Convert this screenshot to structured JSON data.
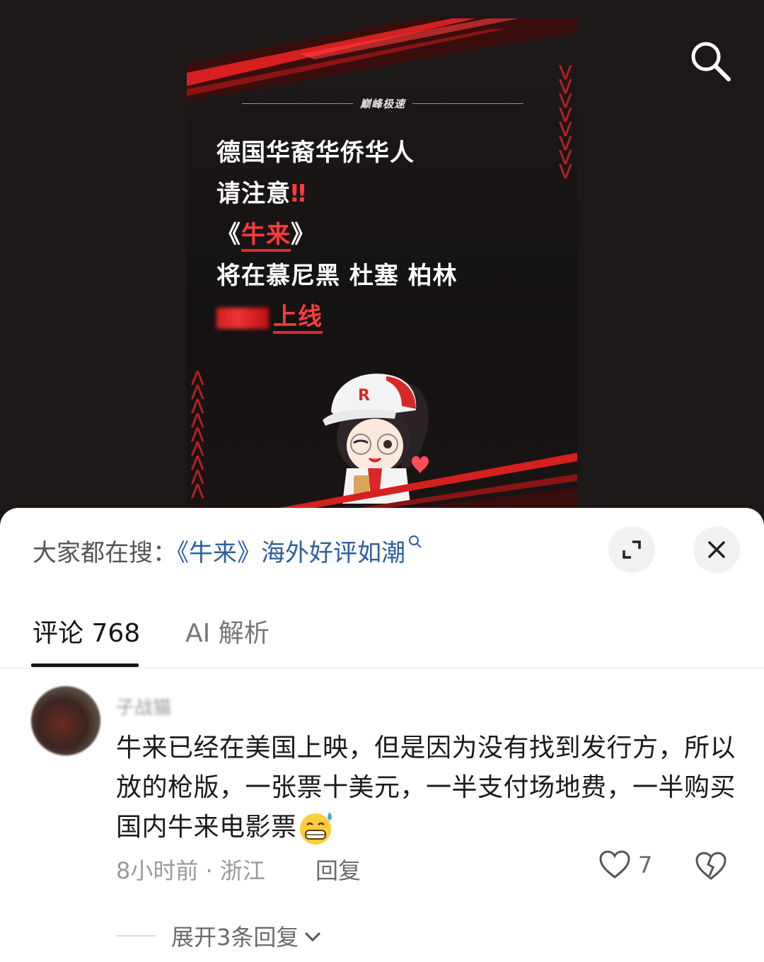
{
  "video": {
    "brand": "巅峰极速",
    "headline": {
      "line1": "德国华裔华侨华人",
      "line2": "请注意",
      "line2_mark": "‼",
      "line3_open": "《",
      "line3_title": "牛来",
      "line3_close": "》",
      "line4": "将在慕尼黑 杜塞 柏林",
      "line5": "上线"
    }
  },
  "search_icon": "search-icon",
  "sheet": {
    "suggestion_prefix": "大家都在搜：",
    "suggestion_link": "《牛来》海外好评如潮",
    "expand_icon": "expand-icon",
    "close_icon": "close-icon"
  },
  "tabs": [
    {
      "label": "评论 768"
    },
    {
      "label": "AI 解析"
    }
  ],
  "comment": {
    "username": "子战猫",
    "text": "牛来已经在美国上映，但是因为没有找到发行方，所以放的枪版，一张票十美元，一半支付场地费，一半购买国内牛来电影票",
    "time": "8小时前",
    "separator": "·",
    "location": "浙江",
    "reply": "回复",
    "likes": "7",
    "expand_replies": "展开3条回复"
  },
  "colors": {
    "accent_red": "#e02a2a",
    "link_blue": "#2d5e9e"
  }
}
